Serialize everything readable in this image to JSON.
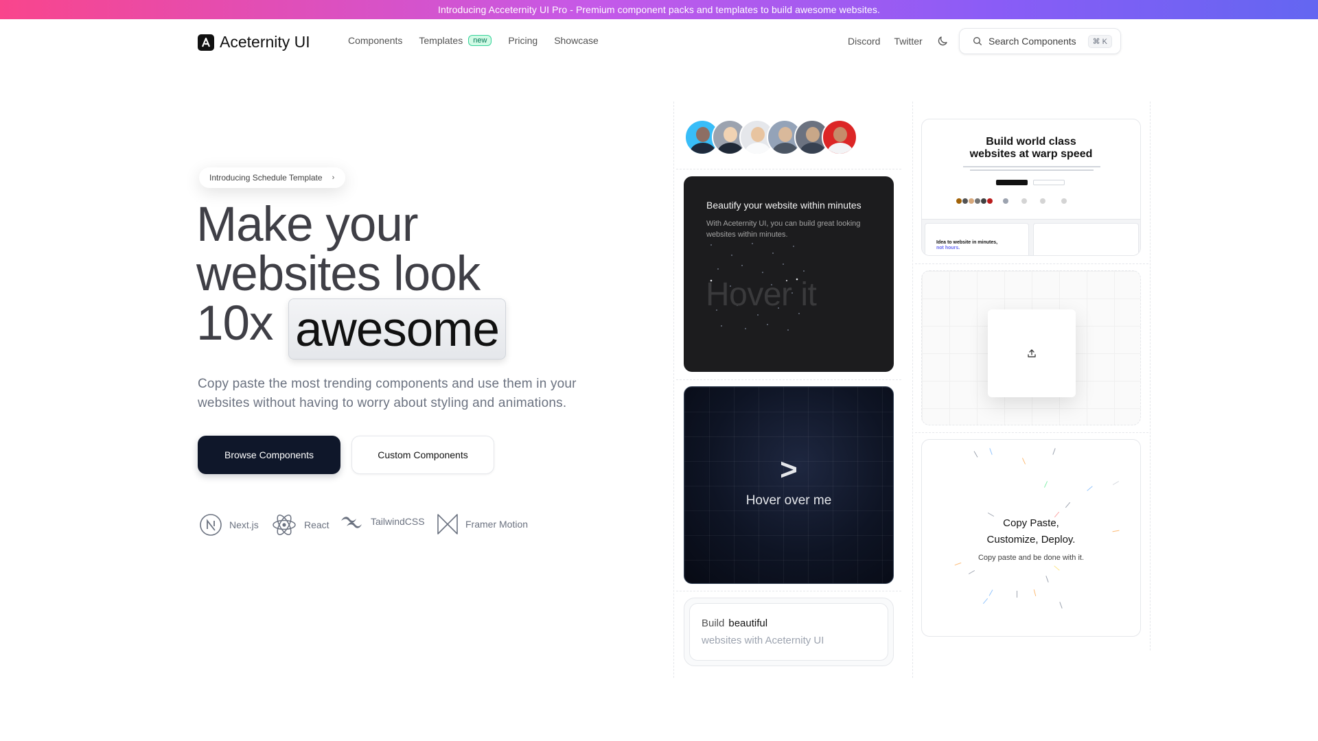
{
  "banner": {
    "text": "Introducing  Acceternity UI Pro  - Premium component packs and templates to build awesome websites."
  },
  "nav": {
    "brand": "Aceternity UI",
    "links": [
      {
        "label": "Components"
      },
      {
        "label": "Templates",
        "badge": "new"
      },
      {
        "label": "Pricing"
      },
      {
        "label": "Showcase"
      }
    ],
    "right_links": [
      {
        "label": "Discord"
      },
      {
        "label": "Twitter"
      }
    ],
    "theme_icon": "moon-icon",
    "search": {
      "placeholder": "Search Components",
      "shortcut": "⌘ K"
    }
  },
  "hero": {
    "pill": "Introducing Schedule Template",
    "headline_line1": "Make your",
    "headline_line2": "websites look",
    "headline_line3_prefix": "10x",
    "headline_highlight": "awesome",
    "subhead": "Copy paste the most trending components and use them in your websites without having to worry about styling and animations.",
    "primary_button": "Browse Components",
    "secondary_button": "Custom Components",
    "tech": [
      {
        "label": "Next.js",
        "icon": "nextjs-icon"
      },
      {
        "label": "React",
        "icon": "react-icon"
      },
      {
        "label": "TailwindCSS",
        "icon": "tailwind-icon"
      },
      {
        "label": "Framer Motion",
        "icon": "framer-motion-icon"
      }
    ]
  },
  "cards": {
    "beautify": {
      "title": "Beautify your website within minutes",
      "desc": "With Aceternity UI, you can build great looking websites within minutes.",
      "hover": "Hover it"
    },
    "hover_over": {
      "arrow": ">",
      "label": "Hover over me"
    },
    "build": {
      "line1_prefix": "Build",
      "line1_word": "beautiful",
      "line2": "websites with Aceternity UI"
    },
    "site_preview": {
      "title_line1": "Build world class",
      "title_line2": "websites at warp speed",
      "sub_heading": "Idea to website in minutes,",
      "sub_highlight": "not hours."
    },
    "copy": {
      "line1": "Copy Paste,",
      "line2": "Customize, Deploy.",
      "sub": "Copy paste and be done with it."
    }
  },
  "colors": {
    "banner_gradient": [
      "#f9458c",
      "#8b5cf6",
      "#6366f1"
    ],
    "primary_button": "#0f172a",
    "badge_bg": "#d1fae5",
    "badge_text": "#047857"
  }
}
